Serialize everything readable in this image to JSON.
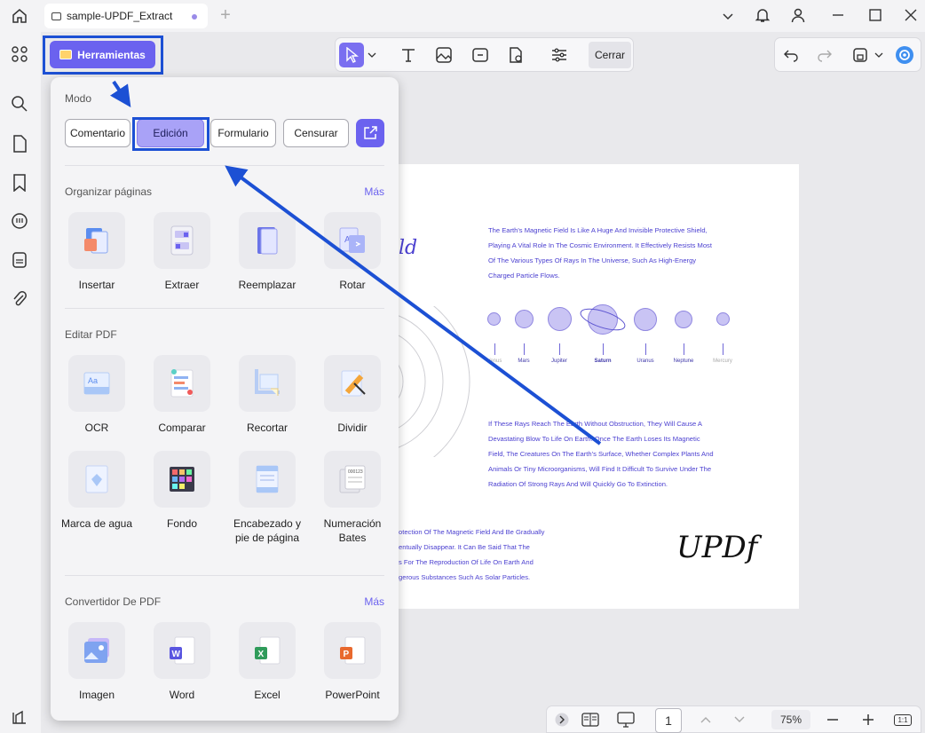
{
  "titlebar": {
    "tab_title": "sample-UPDF_Extract"
  },
  "toolbar": {
    "tools_button": "Herramientas",
    "close_button": "Cerrar"
  },
  "panel": {
    "mode_label": "Modo",
    "modes": [
      "Comentario",
      "Edición",
      "Formulario",
      "Censurar"
    ],
    "organize": {
      "title": "Organizar páginas",
      "more": "Más",
      "tools": [
        "Insertar",
        "Extraer",
        "Reemplazar",
        "Rotar"
      ]
    },
    "edit": {
      "title": "Editar PDF",
      "tools": [
        "OCR",
        "Comparar",
        "Recortar",
        "Dividir",
        "Marca de agua",
        "Fondo",
        "Encabezado y pie de página",
        "Numeración Bates"
      ]
    },
    "convert": {
      "title": "Convertidor De PDF",
      "more": "Más",
      "tools": [
        "Imagen",
        "Word",
        "Excel",
        "PowerPoint"
      ]
    }
  },
  "document": {
    "field_word": "ld",
    "para1": [
      "The Earth's Magnetic Field Is Like A Huge And Invisible Protective Shield,",
      "Playing A Vital Role In The Cosmic Environment. It Effectively Resists Most",
      "Of The Various Types Of Rays In The Universe, Such As High-Energy",
      "Charged Particle Flows."
    ],
    "planets": [
      "Venus",
      "Mars",
      "Jupiter",
      "Saturn",
      "Uranus",
      "Neptune",
      "Mercury"
    ],
    "para2": [
      "If These Rays Reach The Earth Without Obstruction, They Will Cause A",
      "Devastating Blow To Life On Earth. Once The Earth Loses Its Magnetic",
      "Field, The Creatures On The Earth's Surface, Whether Complex Plants And",
      "Animals Or Tiny Microorganisms, Will Find It Difficult To Survive Under The",
      "Radiation Of Strong Rays And Will Quickly Go To Extinction."
    ],
    "para3": [
      "otection Of The Magnetic Field And Be Gradually",
      "entually Disappear. It Can Be Said That The",
      "s For The Reproduction Of Life On Earth And",
      "gerous Substances Such As Solar Particles."
    ],
    "signature": "UPDf"
  },
  "bottombar": {
    "page": "1",
    "zoom": "75%",
    "fit": "1:1"
  },
  "colors": {
    "accent": "#6b62ef",
    "highlight": "#1c50d4"
  }
}
